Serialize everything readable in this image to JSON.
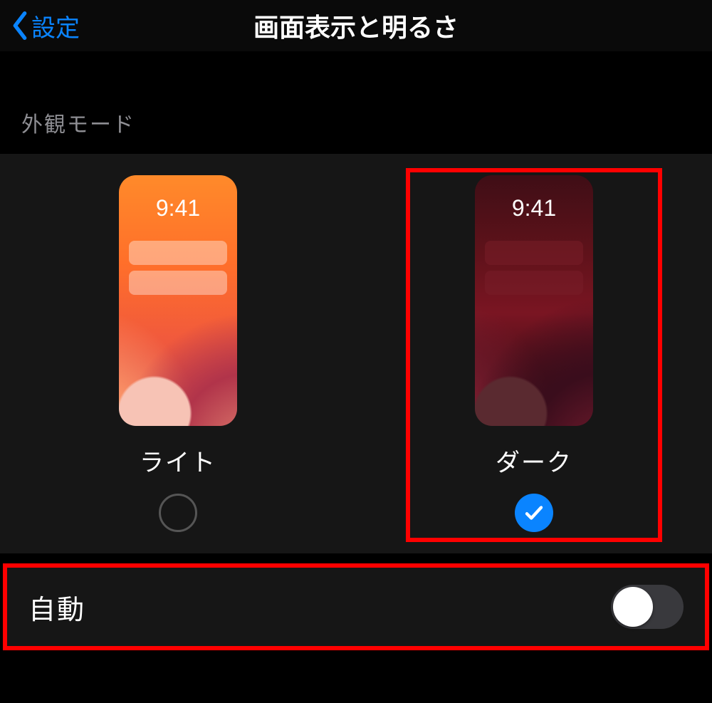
{
  "header": {
    "back_label": "設定",
    "title": "画面表示と明るさ"
  },
  "section": {
    "appearance_header": "外観モード"
  },
  "appearance": {
    "preview_time": "9:41",
    "options": [
      {
        "label": "ライト",
        "selected": false
      },
      {
        "label": "ダーク",
        "selected": true
      }
    ]
  },
  "automatic": {
    "label": "自動",
    "enabled": false
  },
  "annotations": {
    "highlight_dark_option": true,
    "highlight_automatic_row": true
  },
  "colors": {
    "accent": "#0a84ff",
    "highlight": "#ff0000"
  }
}
